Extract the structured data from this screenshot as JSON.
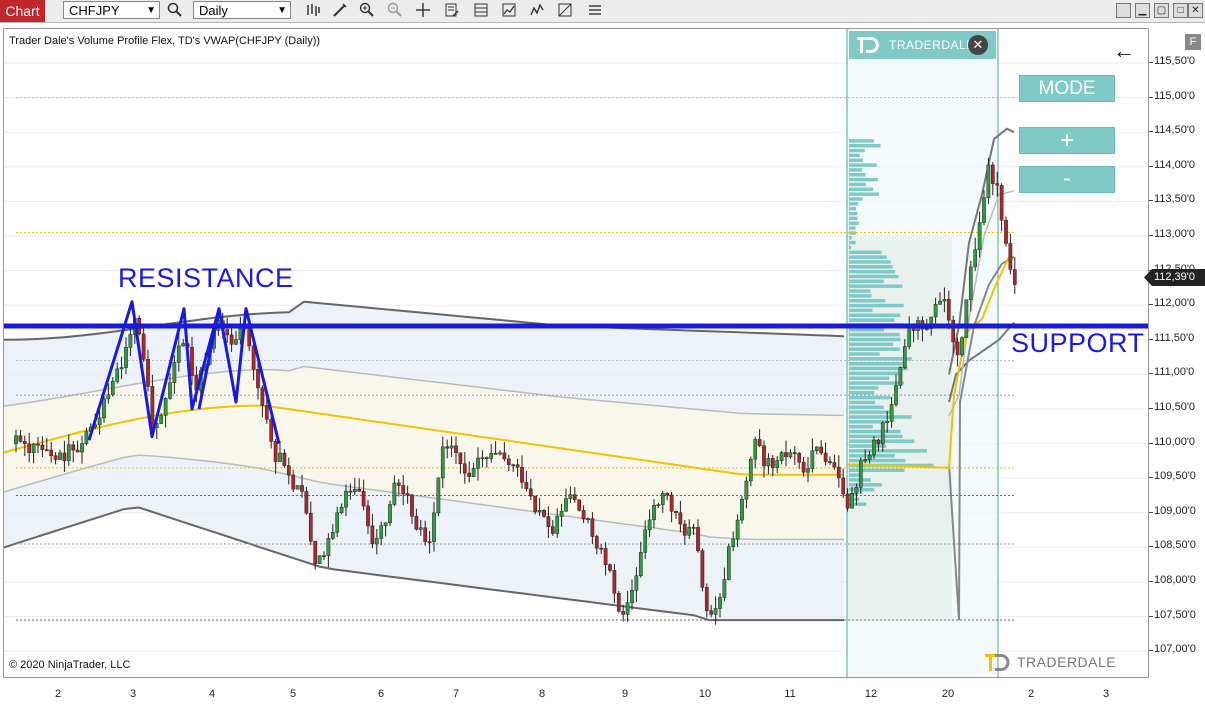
{
  "toolbar": {
    "tab_label": "Chart",
    "instrument": "CHFJPY",
    "interval": "Daily",
    "icons": [
      "search-icon",
      "bar-type-icon",
      "draw-tool-icon",
      "zoom-in-icon",
      "zoom-out-icon",
      "crosshair-icon",
      "properties-icon",
      "data-box-icon",
      "strategies-icon",
      "indicators-icon"
    ],
    "window_buttons": [
      "restore-icon",
      "minimize-icon",
      "maximize-icon",
      "close-icon"
    ]
  },
  "chart": {
    "title": "Trader Dale's Volume Profile Flex, TD's VWAP(CHFJPY (Daily))",
    "copyright": "© 2020 NinjaTrader, LLC",
    "current_price": "112,39'0",
    "resistance_label": "RESISTANCE",
    "support_label": "SUPPORT",
    "support_resistance_level": 111.7,
    "price_labels": [
      "115,50'0",
      "115,00'0",
      "114,50'0",
      "114,00'0",
      "113,50'0",
      "113,00'0",
      "112,50'0",
      "112,00'0",
      "111,50'0",
      "111,00'0",
      "110,50'0",
      "110,00'0",
      "109,50'0",
      "109,00'0",
      "108,50'0",
      "108,00'0",
      "107,50'0",
      "107,00'0"
    ],
    "time_labels": [
      "2",
      "3",
      "4",
      "5",
      "6",
      "7",
      "8",
      "9",
      "10",
      "11",
      "12",
      "20",
      "2",
      "3"
    ],
    "colors": {
      "bull_candle": "#2e9e3e",
      "bear_candle": "#b0262c",
      "vwap": "#f2c300",
      "bands": "#555555",
      "annotation": "#1a1adc",
      "profile": "#7fcac6"
    }
  },
  "panel": {
    "brand_header": "TRADERDALE",
    "brand_footer": "TRADERDALE",
    "mode_label": "MODE",
    "plus_label": "+",
    "minus_label": "-",
    "back_icon": "left-arrow-icon",
    "f_label": "F"
  }
}
